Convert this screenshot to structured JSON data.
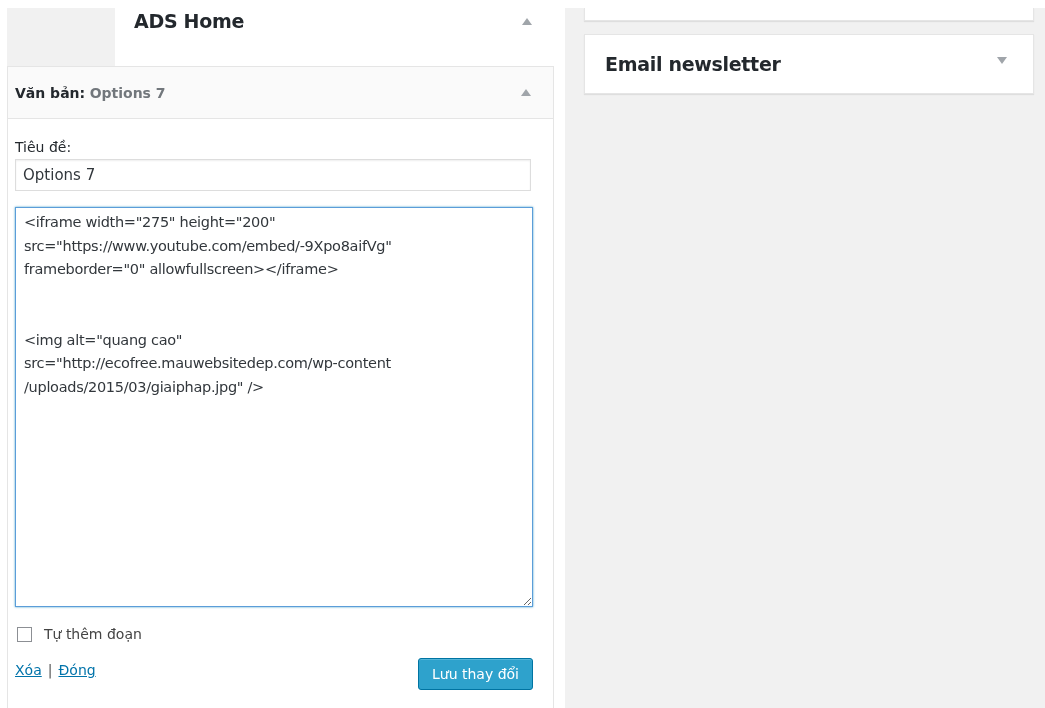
{
  "left_widget_header": {
    "title": "ADS Home",
    "expanded": true
  },
  "widget": {
    "type_label": "Văn bản:",
    "name": "Options 7",
    "expanded": true,
    "title_label": "Tiêu đề:",
    "title_value": "Options 7",
    "content": "<iframe width=\"275\" height=\"200\"\nsrc=\"https://www.youtube.com/embed/-9Xpo8aifVg\"\nframeborder=\"0\" allowfullscreen></iframe>\n\n\n<img alt=\"quang cao\"\nsrc=\"http://ecofree.mauwebsitedep.com/wp-content\n/uploads/2015/03/giaiphap.jpg\" />",
    "auto_paragraph": {
      "label": "Tự thêm đoạn",
      "checked": false
    },
    "links": [
      "Xóa",
      "Đóng"
    ],
    "separator": "|",
    "save_button": "Lưu thay đổi"
  },
  "right_widgets": [
    {
      "title": "Email newsletter",
      "expanded": false
    }
  ]
}
